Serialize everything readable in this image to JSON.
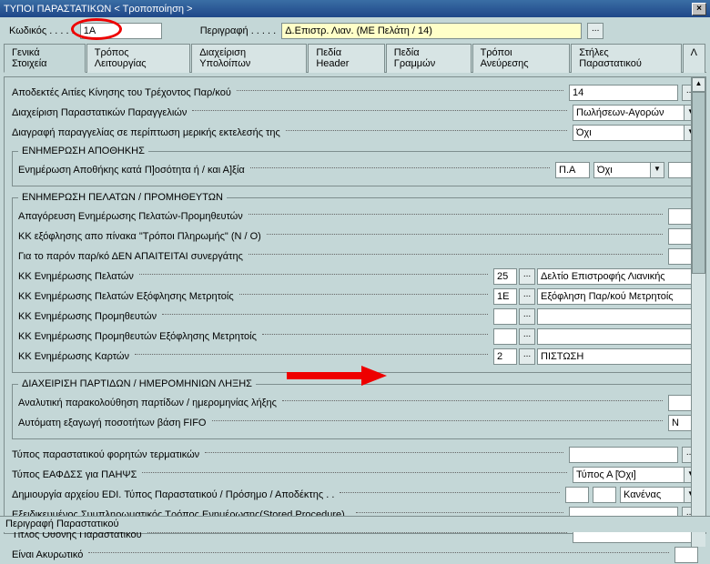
{
  "window": {
    "title": "ΤΥΠΟΙ ΠΑΡΑΣΤΑΤΙΚΩΝ < Τροποποίηση >",
    "close_label": "×"
  },
  "header": {
    "kodikos_label": "Κωδικός . . . . .",
    "kodikos_value": "1A",
    "perigrafi_label": "Περιγραφή . . . . .",
    "perigrafi_value": "Δ.Επιστρ. Λιαν. (ΜΕ Πελάτη / 14)"
  },
  "tabs": [
    "Γενικά Στοιχεία",
    "Τρόπος Λειτουργίας",
    "Διαχείριση Υπολοίπων",
    "Πεδία Header",
    "Πεδία Γραμμών",
    "Τρόποι Ανεύρεσης",
    "Στήλες Παραστατικού",
    "Λ"
  ],
  "rows": {
    "r1_label": "Αποδεκτές Αιτίες Κίνησης του Τρέχοντος Παρ/κού",
    "r1_value": "14",
    "r2_label": "Διαχείριση Παραστατικών Παραγγελιών",
    "r2_value": "Πωλήσεων-Αγορών",
    "r3_label": "Διαγραφή παραγγελίας σε περίπτωση μερικής εκτελεσής της",
    "r3_value": "Όχι"
  },
  "fs1": {
    "legend": "ΕΝΗΜΕΡΩΣΗ ΑΠΟΘΗΚΗΣ",
    "r1_label": "Ενημέρωση Αποθήκης κατά Π]οσότητα ή / και Α]ξία",
    "r1_val1": "Π.Α",
    "r1_val2": "Όχι"
  },
  "fs2": {
    "legend": "ΕΝΗΜΕΡΩΣΗ ΠΕΛΑΤΩΝ / ΠΡΟΜΗΘΕΥΤΩΝ",
    "r1_label": "Απαγόρευση Ενημέρωσης Πελατών-Προμηθευτών",
    "r2_label": "ΚΚ εξόφλησης απο πίνακα \"Τρόποι Πληρωμής\" (Ν / Ο)",
    "r3_label": "Για το παρόν παρ/κό ΔΕΝ ΑΠΑΙΤΕΙΤΑΙ συνεργάτης",
    "r4_label": "ΚΚ Ενημέρωσης Πελατών",
    "r4_code": "25",
    "r4_desc": "Δελτίο Επιστροφής Λιανικής",
    "r5_label": "ΚΚ Ενημέρωσης Πελατών Εξόφλησης Μετρητοίς",
    "r5_code": "1E",
    "r5_desc": "Εξόφληση Παρ/κού Μετρητοίς",
    "r6_label": "ΚΚ Ενημέρωσης Προμηθευτών",
    "r7_label": "ΚΚ Ενημέρωσης Προμηθευτών Εξόφλησης Μετρητοίς",
    "r8_label": "ΚΚ Ενημέρωσης Καρτών",
    "r8_code": "2",
    "r8_desc": "ΠΙΣΤΩΣΗ"
  },
  "fs3": {
    "legend": "ΔΙΑΧΕΙΡΙΣΗ ΠΑΡΤΙΔΩΝ / ΗΜΕΡΟΜΗΝΙΩΝ ΛΗΞΗΣ",
    "r1_label": "Αναλυτική παρακολούθηση παρτίδων / ημερομηνίας λήξης",
    "r2_label": "Αυτόματη εξαγωγή ποσοτήτων βάση FIFO",
    "r2_value": "N"
  },
  "bottom": {
    "r1_label": "Τύπος παραστατικού φορητών τερματικών",
    "r2_label": "Τύπος ΕΑΦΔΣΣ για ΠΑΗΨΣ",
    "r2_value": "Τύπος Α [Όχι]",
    "r3_label": "Δημιουργία αρχείου EDI. Τύπος Παραστατικού / Πρόσημο / Αποδέκτης . .",
    "r3_val3": "Κανένας",
    "r4_label": "Εξειδικευμένος Συμπληρωματικός Τρόπος Ενημέρωσης(Stored Procedure) .",
    "r5_label": "Τίτλος Οθόνης Παραστατικού",
    "r6_label": "Είναι Ακυρωτικό"
  },
  "status": "Περιγραφή Παραστατικού",
  "ellipsis": "..."
}
